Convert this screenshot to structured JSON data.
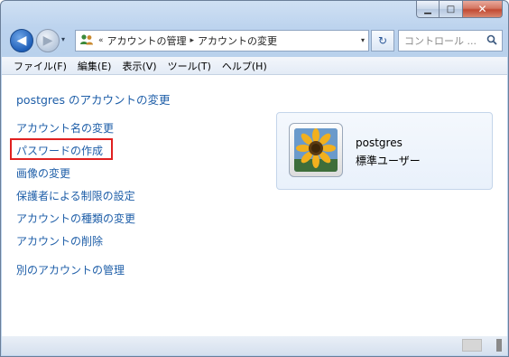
{
  "window": {
    "caption": {
      "minimize": "▁",
      "maximize": "□",
      "close": "✕"
    }
  },
  "nav": {
    "back_icon": "◀",
    "forward_icon": "▶",
    "history_dropdown": "▾",
    "address": {
      "icon": "users-icon",
      "overflow": "«",
      "segments": [
        "アカウントの管理",
        "アカウントの変更"
      ],
      "separator": "▸",
      "dropdown": "▾"
    },
    "refresh_icon": "↻",
    "search": {
      "placeholder": "コントロール ..."
    }
  },
  "menubar": {
    "items": [
      "ファイル(F)",
      "編集(E)",
      "表示(V)",
      "ツール(T)",
      "ヘルプ(H)"
    ]
  },
  "main": {
    "title": "postgres のアカウントの変更",
    "links": [
      "アカウント名の変更",
      "パスワードの作成",
      "画像の変更",
      "保護者による制限の設定",
      "アカウントの種類の変更",
      "アカウントの削除"
    ],
    "other_link": "別のアカウントの管理",
    "highlighted_link_index": 1,
    "highlight_color": "#e02020"
  },
  "user_card": {
    "name": "postgres",
    "type": "標準ユーザー",
    "picture": "sunflower-picture"
  },
  "colors": {
    "link": "#1e5ea8",
    "window_frame": "#bcd3ee"
  }
}
